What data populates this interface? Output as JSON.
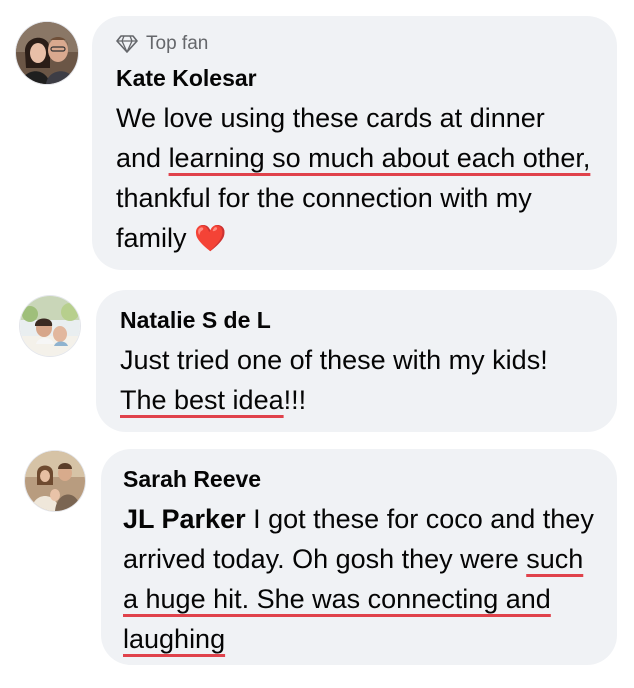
{
  "comments": [
    {
      "badge": "Top fan",
      "badge_icon": "diamond-icon",
      "author": "Kate Kolesar",
      "text_before": "We love using these cards at dinner and ",
      "text_highlight": "learning so much about each other,",
      "text_after": " thankful for the connection with my family ",
      "emoji": "❤️"
    },
    {
      "author": "Natalie S de L",
      "text_before": "Just tried one of these with my kids! ",
      "text_highlight": "The best idea",
      "text_after": "!!!"
    },
    {
      "author": "Sarah Reeve",
      "mention": "JL Parker",
      "text_before": " I got these for coco and they arrived today. Oh gosh they were ",
      "text_highlight": "such a huge hit. She was connecting and laughing"
    }
  ],
  "colors": {
    "bubble": "#f0f2f5",
    "highlight_underline": "#e0424b",
    "secondary_text": "#65676b"
  }
}
